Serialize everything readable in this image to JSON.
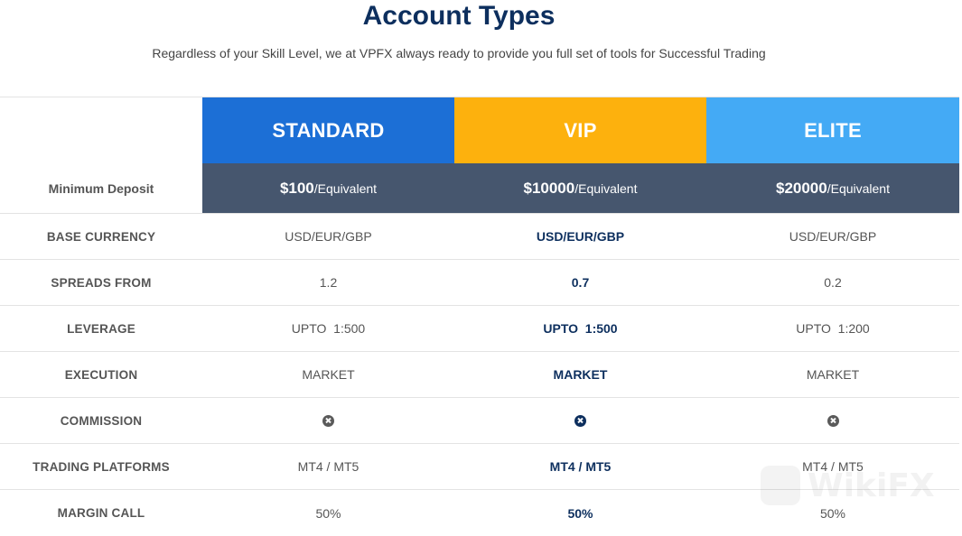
{
  "header": {
    "title": "Account Types",
    "subtitle": "Regardless of your Skill Level, we at VPFX always ready to provide you full set of tools for Successful Trading"
  },
  "plans": [
    {
      "name": "STANDARD",
      "color": "#1c6fd6",
      "deposit_amount": "$100",
      "deposit_suffix": "/Equivalent"
    },
    {
      "name": "VIP",
      "color": "#fdb10d",
      "deposit_amount": "$10000",
      "deposit_suffix": "/Equivalent"
    },
    {
      "name": "ELITE",
      "color": "#44aaf5",
      "deposit_amount": "$20000",
      "deposit_suffix": "/Equivalent"
    }
  ],
  "deposit_label": "Minimum Deposit",
  "colors": {
    "deposit_band": "#46566e",
    "title": "#0d2f5e",
    "vip_text": "#0d2f5e"
  },
  "features": [
    {
      "label": "BASE CURRENCY",
      "values": [
        "USD/EUR/GBP",
        "USD/EUR/GBP",
        "USD/EUR/GBP"
      ]
    },
    {
      "label": "SPREADS FROM",
      "values": [
        "1.2",
        "0.7",
        "0.2"
      ]
    },
    {
      "label": "LEVERAGE",
      "values": [
        "UPTO  1:500",
        "UPTO  1:500",
        "UPTO  1:200"
      ]
    },
    {
      "label": "EXECUTION",
      "values": [
        "MARKET",
        "MARKET",
        "MARKET"
      ]
    },
    {
      "label": "COMMISSION",
      "icon": "close-circle-icon"
    },
    {
      "label": "TRADING PLATFORMS",
      "values": [
        "MT4 / MT5",
        "MT4 / MT5",
        "MT4 / MT5"
      ]
    },
    {
      "label": "MARGIN CALL",
      "values": [
        "50%",
        "50%",
        "50%"
      ]
    }
  ],
  "watermark": {
    "text": "WikiFX",
    "icon": "wikifx-logo-icon"
  }
}
